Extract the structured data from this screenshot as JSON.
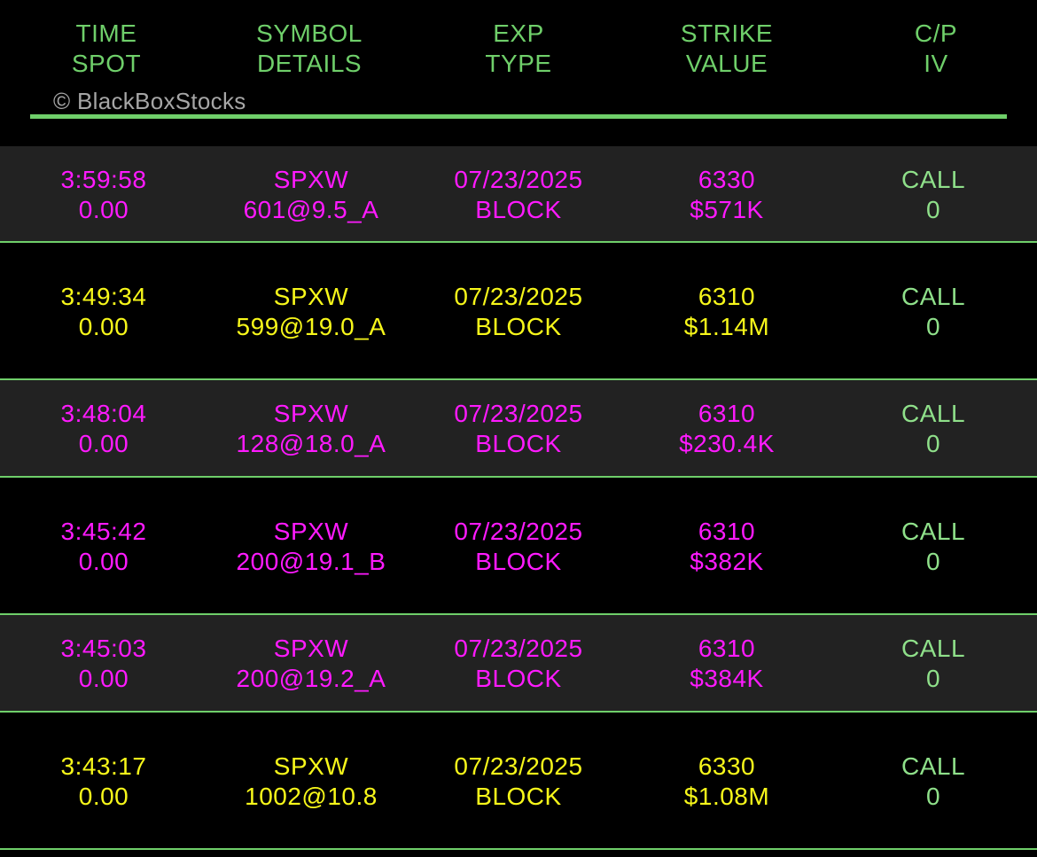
{
  "colors": {
    "background": "#000000",
    "alt_row_background": "#222222",
    "header_text": "#6fcf6a",
    "accent_green": "#6fcf6a",
    "call_green": "#8fe08a",
    "magenta": "#ff1aff",
    "yellow": "#f7f71a",
    "copyright_gray": "#a6a6a6"
  },
  "header": {
    "columns": [
      {
        "line1": "TIME",
        "line2": "SPOT"
      },
      {
        "line1": "SYMBOL",
        "line2": "DETAILS"
      },
      {
        "line1": "EXP",
        "line2": "TYPE"
      },
      {
        "line1": "STRIKE",
        "line2": "VALUE"
      },
      {
        "line1": "C/P",
        "line2": "IV"
      }
    ],
    "copyright": "© BlackBoxStocks"
  },
  "rows": [
    {
      "time": "3:59:58",
      "spot": "0.00",
      "symbol": "SPXW",
      "details": "601@9.5_A",
      "exp": "07/23/2025",
      "type": "BLOCK",
      "strike": "6330",
      "value": "$571K",
      "cp": "CALL",
      "iv": "0",
      "color": "magenta",
      "shaded": true
    },
    {
      "time": "3:49:34",
      "spot": "0.00",
      "symbol": "SPXW",
      "details": "599@19.0_A",
      "exp": "07/23/2025",
      "type": "BLOCK",
      "strike": "6310",
      "value": "$1.14M",
      "cp": "CALL",
      "iv": "0",
      "color": "yellow",
      "shaded": false
    },
    {
      "time": "3:48:04",
      "spot": "0.00",
      "symbol": "SPXW",
      "details": "128@18.0_A",
      "exp": "07/23/2025",
      "type": "BLOCK",
      "strike": "6310",
      "value": "$230.4K",
      "cp": "CALL",
      "iv": "0",
      "color": "magenta",
      "shaded": true
    },
    {
      "time": "3:45:42",
      "spot": "0.00",
      "symbol": "SPXW",
      "details": "200@19.1_B",
      "exp": "07/23/2025",
      "type": "BLOCK",
      "strike": "6310",
      "value": "$382K",
      "cp": "CALL",
      "iv": "0",
      "color": "magenta",
      "shaded": false
    },
    {
      "time": "3:45:03",
      "spot": "0.00",
      "symbol": "SPXW",
      "details": "200@19.2_A",
      "exp": "07/23/2025",
      "type": "BLOCK",
      "strike": "6310",
      "value": "$384K",
      "cp": "CALL",
      "iv": "0",
      "color": "magenta",
      "shaded": true
    },
    {
      "time": "3:43:17",
      "spot": "0.00",
      "symbol": "SPXW",
      "details": "1002@10.8",
      "exp": "07/23/2025",
      "type": "BLOCK",
      "strike": "6330",
      "value": "$1.08M",
      "cp": "CALL",
      "iv": "0",
      "color": "yellow",
      "shaded": false
    }
  ]
}
